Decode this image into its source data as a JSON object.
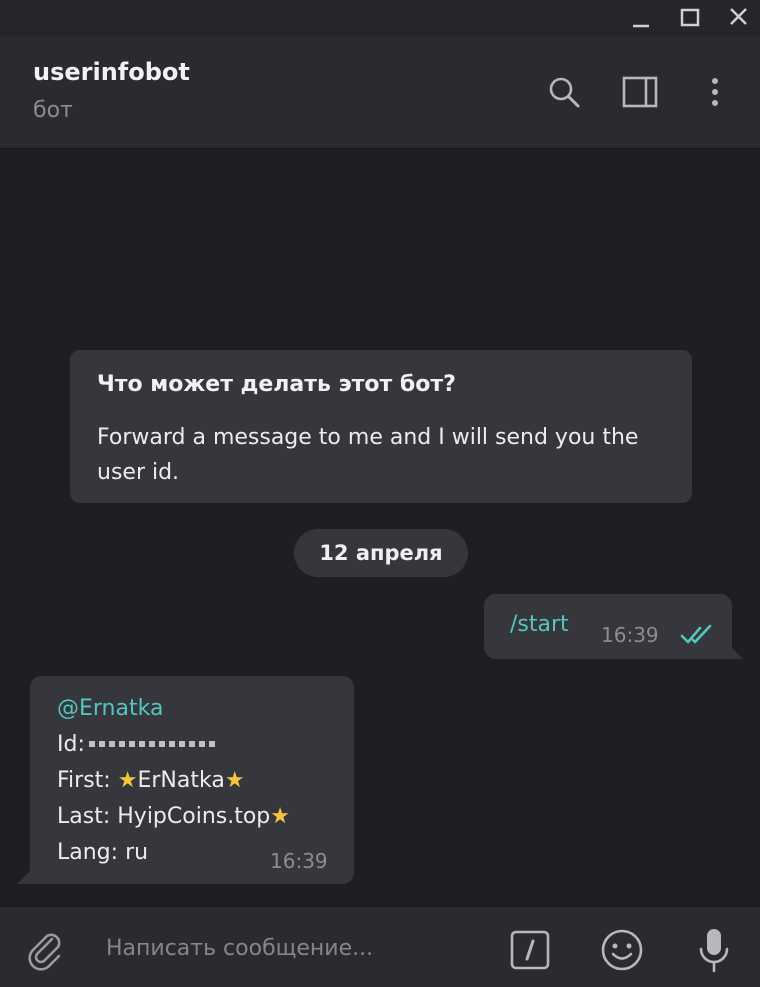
{
  "window": {
    "controls": [
      "minimize-icon",
      "maximize-icon",
      "close-icon"
    ]
  },
  "header": {
    "title": "userinfobot",
    "subtitle": "бот",
    "actions": [
      "search-icon",
      "sidebar-toggle-icon",
      "more-vertical-icon"
    ]
  },
  "bot_info": {
    "title": "Что может делать этот бот?",
    "description": "Forward a message to me and I will send you the user id."
  },
  "date_separator": "12 апреля",
  "outgoing_message": {
    "text": "/start",
    "time": "16:39",
    "status": "read"
  },
  "incoming_message": {
    "mention": "@Ernatka",
    "id_label": "Id:",
    "first_label": "First:",
    "first_name": "ErNatka",
    "last_label": "Last:",
    "last_name": "HyipCoins.top",
    "lang_label": "Lang:",
    "lang_value": "ru",
    "time": "16:39"
  },
  "composer": {
    "placeholder": "Написать сообщение...",
    "icons": [
      "attach-icon",
      "bot-command-icon",
      "emoji-icon",
      "microphone-icon"
    ]
  },
  "colors": {
    "background": "#1e1e23",
    "header": "#2a2b31",
    "bubble": "#36373d",
    "accent": "#54c6c0",
    "muted_text": "#8c8d92",
    "star": "#f5c542"
  }
}
